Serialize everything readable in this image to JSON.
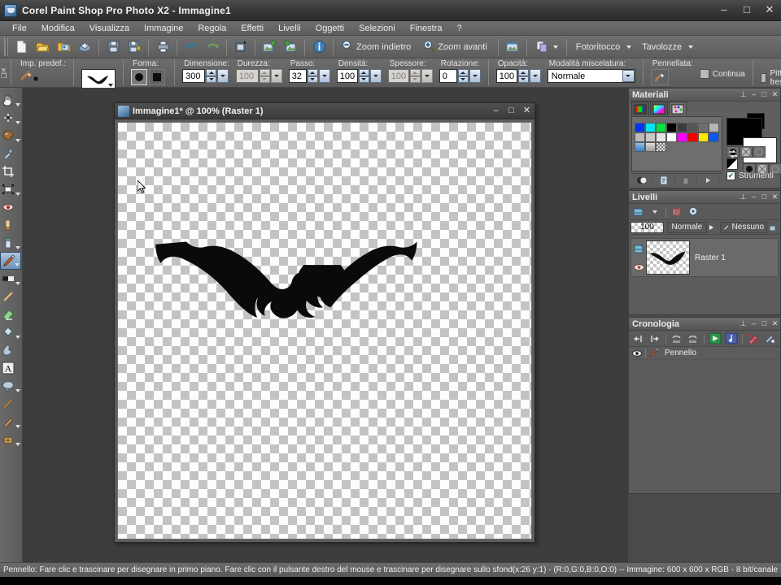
{
  "app": {
    "title": "Corel Paint Shop Pro Photo X2 - Immagine1",
    "icon": "app-icon",
    "window_buttons": {
      "minimize": "–",
      "maximize": "□",
      "close": "✕"
    }
  },
  "menubar": {
    "items": [
      {
        "label": "File"
      },
      {
        "label": "Modifica"
      },
      {
        "label": "Visualizza"
      },
      {
        "label": "Immagine"
      },
      {
        "label": "Regola"
      },
      {
        "label": "Effetti"
      },
      {
        "label": "Livelli"
      },
      {
        "label": "Oggetti"
      },
      {
        "label": "Selezioni"
      },
      {
        "label": "Finestra"
      },
      {
        "label": "?"
      }
    ]
  },
  "toolbar": {
    "buttons": [
      {
        "name": "new-icon"
      },
      {
        "name": "open-icon"
      },
      {
        "name": "browse-icon"
      },
      {
        "name": "share-icon"
      },
      {
        "name": "save-icon"
      },
      {
        "name": "save-as-icon"
      },
      {
        "name": "print-icon"
      },
      {
        "name": "undo-icon"
      },
      {
        "name": "redo-icon"
      },
      {
        "name": "screenshot-icon"
      },
      {
        "name": "import-icon"
      },
      {
        "name": "export-icon"
      },
      {
        "name": "info-icon"
      }
    ],
    "zoom_out_label": "Zoom indietro",
    "zoom_in_label": "Zoom avanti",
    "fullscreen_icon": "fullscreen-icon",
    "copy_icon": "copy-icon",
    "retouch_label": "Fotoritocco",
    "palettes_label": "Tavolozze"
  },
  "options": {
    "preset_label": "Imp. predef.:",
    "preset_brush_icon": "bat-brush-preview",
    "shape_label": "Forma:",
    "shape_round_icon": "round-shape-icon",
    "shape_square_icon": "square-shape-icon",
    "fields": [
      {
        "label": "Dimensione:",
        "value": "300",
        "disabled": false
      },
      {
        "label": "Durezza:",
        "value": "100",
        "disabled": true
      },
      {
        "label": "Passo:",
        "value": "32",
        "disabled": false
      },
      {
        "label": "Densità:",
        "value": "100",
        "disabled": false
      },
      {
        "label": "Spessore:",
        "value": "100",
        "disabled": true
      },
      {
        "label": "Rotazione:",
        "value": "0",
        "disabled": false
      },
      {
        "label": "Opacità:",
        "value": "100",
        "disabled": false
      }
    ],
    "blend_label": "Modalità miscelatura:",
    "blend_value": "Normale",
    "stroke_label": "Pennellata:",
    "stroke_icon": "stroke-icon",
    "continuous_label": "Continua",
    "wetpaint_label": "Pittura fresca"
  },
  "tools": [
    {
      "name": "pan-tool",
      "icon": "hand-icon",
      "arrow": true,
      "selected": false
    },
    {
      "name": "zoom-tool",
      "icon": "magnifier-icon",
      "arrow": true,
      "selected": false
    },
    {
      "name": "palette-tool",
      "icon": "palette-icon",
      "arrow": true,
      "selected": false
    },
    {
      "name": "dropper-tool",
      "icon": "eyedropper-icon",
      "arrow": false,
      "selected": false
    },
    {
      "name": "crop-tool",
      "icon": "crop-icon",
      "arrow": false,
      "selected": false
    },
    {
      "name": "move-tool",
      "icon": "move-icon",
      "arrow": true,
      "selected": false
    },
    {
      "name": "redeye-tool",
      "icon": "redeye-icon",
      "arrow": false,
      "selected": false
    },
    {
      "name": "makeover-tool",
      "icon": "makeover-icon",
      "arrow": false,
      "selected": false
    },
    {
      "name": "clone-tool",
      "icon": "clone-brush-icon",
      "arrow": true,
      "selected": false
    },
    {
      "name": "paintbrush-tool",
      "icon": "paintbrush-icon",
      "arrow": true,
      "selected": true
    },
    {
      "name": "lighten-darken-tool",
      "icon": "lighten-darken-icon",
      "arrow": true,
      "selected": false
    },
    {
      "name": "retouch-tool",
      "icon": "retouch-icon",
      "arrow": false,
      "selected": false
    },
    {
      "name": "eraser-tool",
      "icon": "eraser-icon",
      "arrow": true,
      "selected": false
    },
    {
      "name": "fill-tool",
      "icon": "paint-bucket-icon",
      "arrow": true,
      "selected": false
    },
    {
      "name": "smudge-tool",
      "icon": "smudge-icon",
      "arrow": false,
      "selected": false
    },
    {
      "name": "text-tool",
      "icon": "text-a-icon",
      "arrow": false,
      "selected": false
    },
    {
      "name": "shape-tool",
      "icon": "speech-bubble-icon",
      "arrow": true,
      "selected": false
    },
    {
      "name": "pen-tool",
      "icon": "pen-icon",
      "arrow": false,
      "selected": false
    },
    {
      "name": "warp-tool",
      "icon": "warp-brush-icon",
      "arrow": true,
      "selected": false
    },
    {
      "name": "mesh-tool",
      "icon": "mesh-warp-icon",
      "arrow": true,
      "selected": false
    }
  ],
  "image_window": {
    "title": "Immagine1* @ 100% (Raster 1)",
    "icon": "document-icon",
    "buttons": {
      "minimize": "–",
      "maximize": "□",
      "close": "✕"
    },
    "artwork": "bat-silhouette",
    "zoom": "100%"
  },
  "panels": {
    "materials": {
      "title": "Materiali",
      "buttons": {
        "pin": "📌",
        "minimize": "–",
        "maximize": "□",
        "close": "✕"
      },
      "tabs": [
        {
          "name": "frame-tab",
          "label": ""
        },
        {
          "name": "rainbow-tab",
          "label": ""
        },
        {
          "name": "swatches-tab",
          "label": "",
          "active": true
        }
      ],
      "swatches": [
        "#0033ff",
        "#00e5f0",
        "#00e13c",
        "#000000",
        "#3c3c3c",
        "#555555",
        "#6e6e6e",
        "#b4b4b4",
        "#b9b9b9",
        "#c8c8c8",
        "#e3e3e3",
        "#ffffff",
        "#ff00ff",
        "#f20000",
        "#ffe800",
        "#0a58e8",
        "#6fa8e0",
        "#b0b0b0",
        "#888888"
      ],
      "foreground": "#000000",
      "background": "#ffffff",
      "tools_checkbox_label": "Strumenti",
      "actions": [
        {
          "name": "add-swatch-icon"
        },
        {
          "name": "edit-swatch-icon"
        },
        {
          "name": "delete-swatch-icon"
        },
        {
          "name": "menu-arrow-icon"
        }
      ]
    },
    "layers": {
      "title": "Livelli",
      "buttons": {
        "pin": "📌",
        "minimize": "–",
        "maximize": "□",
        "close": "✕"
      },
      "toolbar": [
        {
          "name": "new-raster-layer-icon"
        },
        {
          "name": "delete-layer-icon"
        },
        {
          "name": "layer-properties-icon"
        }
      ],
      "opacity": "100",
      "blend_mode": "Normale",
      "link_set": "Nessuno",
      "rows": [
        {
          "name": "Raster 1",
          "visible": true,
          "thumb": "bat-thumb"
        }
      ]
    },
    "history": {
      "title": "Cronologia",
      "buttons": {
        "pin": "📌",
        "minimize": "–",
        "maximize": "□",
        "close": "✕"
      },
      "toolbar": [
        {
          "name": "undo-step-icon"
        },
        {
          "name": "redo-step-icon"
        },
        {
          "name": "undo-selected-icon"
        },
        {
          "name": "redo-selected-icon"
        },
        {
          "name": "play-quickscript-icon"
        },
        {
          "name": "save-quickscript-icon"
        },
        {
          "name": "delete-action-icon"
        },
        {
          "name": "history-options-icon"
        }
      ],
      "rows": [
        {
          "label": "Pennello",
          "icon": "brush-icon",
          "visible": true
        }
      ]
    }
  },
  "statusbar": {
    "hint": "Pennello: Fare clic e trascinare per disegnare in primo piano. Fare clic con il pulsante destro del mouse e trascinare per disegnare sullo sfondo.",
    "info": "(x:26 y:1) - (R:0,G:0,B:0,O:0) -- Immagine:  600 x 600 x RGB - 8 bit/canale"
  }
}
